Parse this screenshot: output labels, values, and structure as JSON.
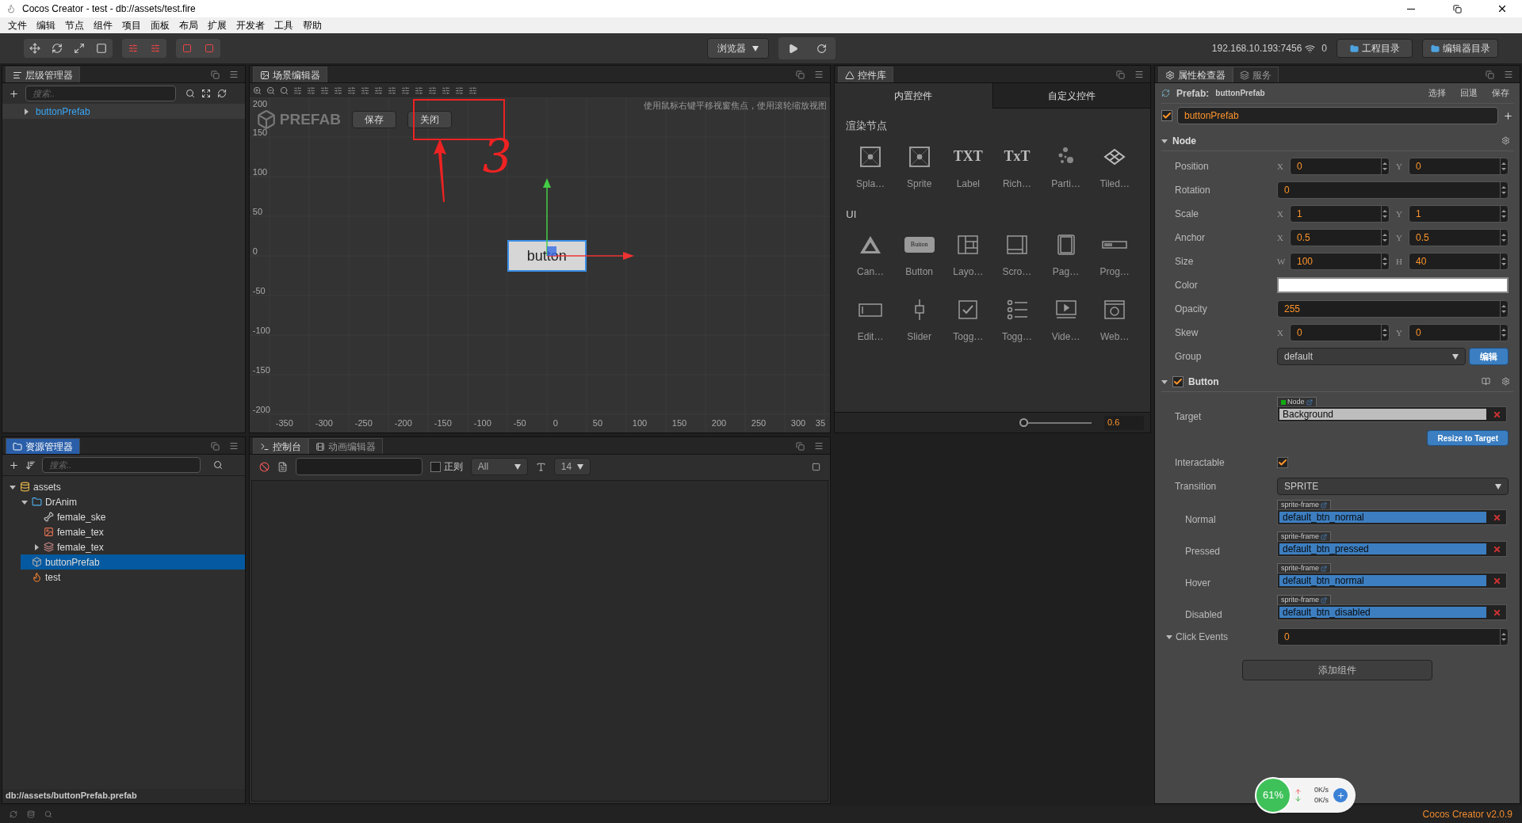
{
  "window": {
    "title": "Cocos Creator - test - db://assets/test.fire"
  },
  "menu": [
    "文件",
    "编辑",
    "节点",
    "组件",
    "项目",
    "面板",
    "布局",
    "扩展",
    "开发者",
    "工具",
    "帮助"
  ],
  "toolbar": {
    "preview": "浏览器",
    "ip": "192.168.10.193:7456",
    "connections": "0",
    "folders": [
      "工程目录",
      "编辑器目录"
    ]
  },
  "hierarchy": {
    "title": "层级管理器",
    "search_placeholder": "搜索..",
    "items": [
      {
        "label": "buttonPrefab",
        "expanded": false
      }
    ]
  },
  "scene": {
    "title": "场景编辑器",
    "prefab_label": "PREFAB",
    "buttons": [
      "保存",
      "关闭"
    ],
    "hint": "使用鼠标右键平移视窗焦点，使用滚轮缩放视图",
    "y_labels": [
      "200",
      "150",
      "100",
      "50",
      "0",
      "-50",
      "-100",
      "-150",
      "-200"
    ],
    "x_labels": [
      "-350",
      "-300",
      "-250",
      "-200",
      "-150",
      "-100",
      "-50",
      "0",
      "50",
      "100",
      "150",
      "200",
      "250",
      "300",
      "35"
    ],
    "node_label": "button",
    "annotation": "3"
  },
  "widgets": {
    "title": "控件库",
    "tabs": [
      {
        "label": "内置控件",
        "selected": true
      },
      {
        "label": "自定义控件",
        "selected": false
      }
    ],
    "sections": [
      {
        "title": "渲染节点",
        "items": [
          {
            "kind": "frame",
            "label": "Spla…"
          },
          {
            "kind": "frame",
            "label": "Sprite"
          },
          {
            "kind": "glyph",
            "glyph": "TXT",
            "label": "Label"
          },
          {
            "kind": "glyph",
            "glyph": "TxT",
            "label": "Rich…"
          },
          {
            "kind": "particle",
            "label": "Parti…"
          },
          {
            "kind": "tiled",
            "label": "Tiled…"
          }
        ]
      },
      {
        "title": "UI",
        "items": [
          {
            "kind": "canvas",
            "label": "Can…"
          },
          {
            "kind": "button",
            "glyph": "Button",
            "label": "Button"
          },
          {
            "kind": "layout",
            "label": "Layo…"
          },
          {
            "kind": "scroll",
            "label": "Scro…"
          },
          {
            "kind": "page",
            "label": "Pag…"
          },
          {
            "kind": "progress",
            "label": "Prog…"
          },
          {
            "kind": "edit",
            "label": "Edit…"
          },
          {
            "kind": "slider",
            "label": "Slider"
          },
          {
            "kind": "toggle",
            "label": "Togg…"
          },
          {
            "kind": "list",
            "label": "Togg…"
          },
          {
            "kind": "video",
            "label": "Vide…"
          },
          {
            "kind": "web",
            "label": "Web…"
          }
        ]
      }
    ],
    "zoom": {
      "level": 0.05,
      "value": "0.6"
    }
  },
  "inspector": {
    "tabs": [
      {
        "label": "属性检查器",
        "selected": true
      },
      {
        "label": "服务",
        "selected": false
      }
    ],
    "prefab_label": "Prefab:",
    "prefab_name": "buttonPrefab",
    "actions": [
      "选择",
      "回退",
      "保存"
    ],
    "node_name": "buttonPrefab",
    "node_active": true,
    "components": [
      {
        "title": "Node",
        "has_checkbox": false,
        "expanded": true,
        "props": [
          {
            "kind": "vec",
            "label": "Position",
            "fields": [
              {
                "axis": "X",
                "value": "0"
              },
              {
                "axis": "Y",
                "value": "0"
              }
            ]
          },
          {
            "kind": "number",
            "label": "Rotation",
            "value": "0"
          },
          {
            "kind": "vec",
            "label": "Scale",
            "fields": [
              {
                "axis": "X",
                "value": "1"
              },
              {
                "axis": "Y",
                "value": "1"
              }
            ]
          },
          {
            "kind": "vec",
            "label": "Anchor",
            "fields": [
              {
                "axis": "X",
                "value": "0.5"
              },
              {
                "axis": "Y",
                "value": "0.5"
              }
            ]
          },
          {
            "kind": "vec",
            "label": "Size",
            "fields": [
              {
                "axis": "W",
                "value": "100"
              },
              {
                "axis": "H",
                "value": "40"
              }
            ]
          },
          {
            "kind": "color",
            "label": "Color",
            "color": "#ffffff"
          },
          {
            "kind": "number",
            "label": "Opacity",
            "value": "255"
          },
          {
            "kind": "vec",
            "label": "Skew",
            "fields": [
              {
                "axis": "X",
                "value": "0"
              },
              {
                "axis": "Y",
                "value": "0"
              }
            ]
          },
          {
            "kind": "select",
            "label": "Group",
            "value": "default",
            "button": "编辑"
          }
        ]
      },
      {
        "title": "Button",
        "has_checkbox": true,
        "checked": true,
        "expanded": true,
        "props": [
          {
            "kind": "noderef",
            "label": "Target",
            "tag": "Node",
            "value": "Background",
            "action": "Resize to Target"
          },
          {
            "kind": "checkbox",
            "label": "Interactable",
            "checked": true
          },
          {
            "kind": "select",
            "label": "Transition",
            "value": "SPRITE"
          },
          {
            "kind": "asset",
            "label": "Normal",
            "tag": "sprite-frame",
            "value": "default_btn_normal"
          },
          {
            "kind": "asset",
            "label": "Pressed",
            "tag": "sprite-frame",
            "value": "default_btn_pressed"
          },
          {
            "kind": "asset",
            "label": "Hover",
            "tag": "sprite-frame",
            "value": "default_btn_normal"
          },
          {
            "kind": "asset",
            "label": "Disabled",
            "tag": "sprite-frame",
            "value": "default_btn_disabled"
          },
          {
            "kind": "list",
            "label": "Click Events",
            "value": "0",
            "expanded": true
          }
        ]
      }
    ],
    "add_component": "添加组件"
  },
  "assets": {
    "title": "资源管理器",
    "search_placeholder": "搜索..",
    "tree": [
      {
        "kind": "db",
        "label": "assets",
        "expanded": true,
        "selected": false,
        "children": [
          {
            "kind": "folder",
            "label": "DrAnim",
            "expanded": true,
            "selected": false,
            "children": [
              {
                "kind": "skeleton",
                "label": "female_ske",
                "selected": false
              },
              {
                "kind": "image",
                "label": "female_tex",
                "selected": false
              },
              {
                "kind": "atlas",
                "label": "female_tex",
                "expanded": false,
                "selected": false
              }
            ]
          },
          {
            "kind": "prefab",
            "label": "buttonPrefab",
            "selected": true
          },
          {
            "kind": "scene",
            "label": "test",
            "selected": false
          }
        ]
      }
    ],
    "path": "db://assets/buttonPrefab.prefab"
  },
  "console": {
    "tabs": [
      {
        "label": "控制台",
        "selected": true
      },
      {
        "label": "动画编辑器",
        "selected": false
      }
    ],
    "regex_label": "正则",
    "regex": false,
    "level": "All",
    "font_size": "14"
  },
  "net": {
    "percent": "61%",
    "up": "0K/s",
    "down": "0K/s"
  },
  "status": {
    "version": "Cocos Creator v2.0.9"
  }
}
